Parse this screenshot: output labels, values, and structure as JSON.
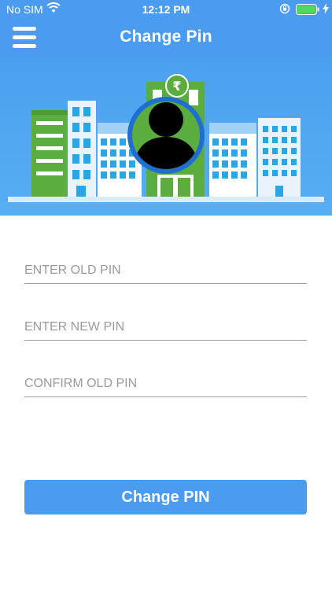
{
  "status_bar": {
    "carrier": "No SIM",
    "time": "12:12 PM",
    "wifi_icon": "wifi-icon",
    "lock_icon": "orientation-lock-icon",
    "battery_icon": "battery-full-icon",
    "charging_icon": "charging-bolt-icon"
  },
  "header": {
    "title": "Change Pin",
    "menu_icon": "hamburger-menu-icon"
  },
  "banner": {
    "illustration": "city-buildings-illustration",
    "currency_symbol": "₹",
    "avatar_icon": "user-avatar-icon"
  },
  "form": {
    "old_pin": {
      "value": "",
      "placeholder": "ENTER OLD PIN"
    },
    "new_pin": {
      "value": "",
      "placeholder": "ENTER NEW PIN"
    },
    "confirm_pin": {
      "value": "",
      "placeholder": "CONFIRM OLD PIN"
    },
    "submit_label": "Change PIN"
  },
  "colors": {
    "primary": "#4b9cf0",
    "banner_green": "#5aad3e",
    "avatar_ring": "#1f6fd0"
  }
}
